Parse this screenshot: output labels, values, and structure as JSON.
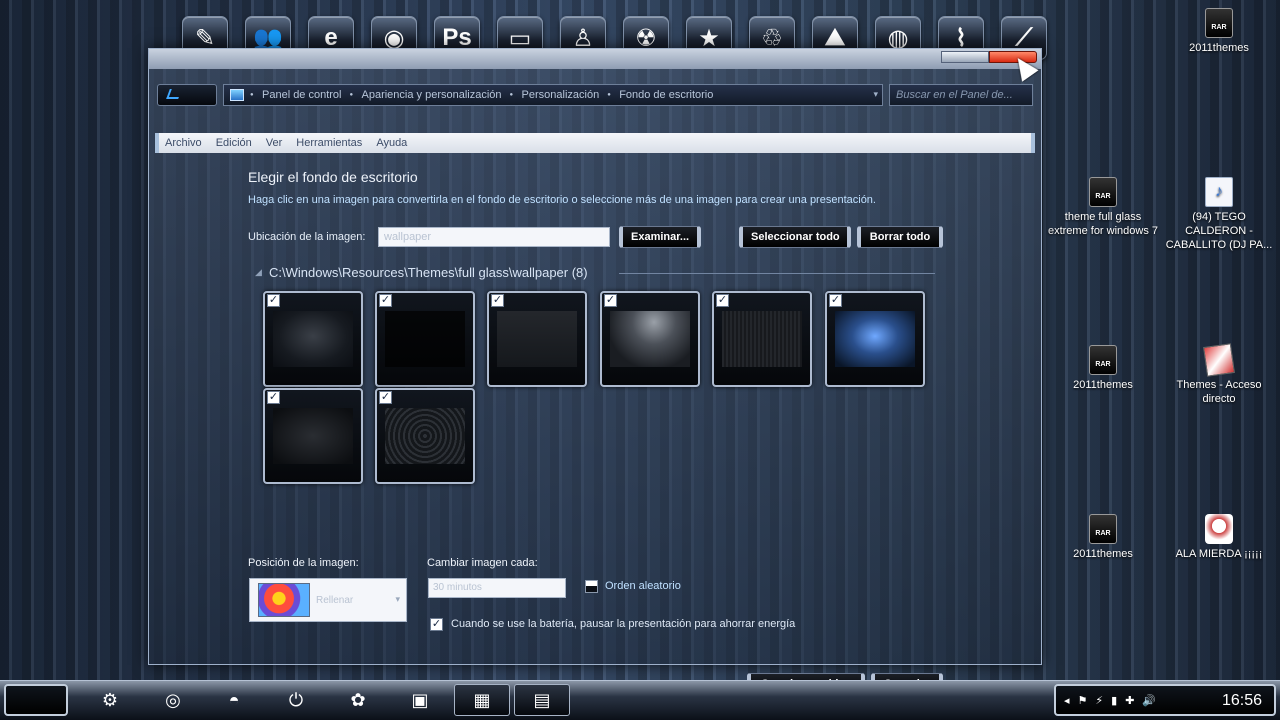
{
  "dock": {
    "icons": [
      {
        "name": "paint-brush-icon",
        "glyph": "✎"
      },
      {
        "name": "people-icon",
        "glyph": "👥"
      },
      {
        "name": "internet-explorer-icon",
        "glyph": "e"
      },
      {
        "name": "disc-icon",
        "glyph": "◉"
      },
      {
        "name": "photoshop-icon",
        "glyph": "Ps"
      },
      {
        "name": "presentation-icon",
        "glyph": "▭"
      },
      {
        "name": "user-lock-icon",
        "glyph": "♙"
      },
      {
        "name": "radiation-icon",
        "glyph": "☢"
      },
      {
        "name": "star-icon",
        "glyph": "★"
      },
      {
        "name": "recycle-icon",
        "glyph": "♲"
      },
      {
        "name": "image-icon",
        "glyph": "⛰"
      },
      {
        "name": "power-ring-icon",
        "glyph": "◍"
      },
      {
        "name": "broom-icon",
        "glyph": "⌇"
      },
      {
        "name": "brush-tool-icon",
        "glyph": "⟋"
      }
    ]
  },
  "desktop_icons": [
    {
      "label": "2011themes",
      "kind": "rar"
    },
    {
      "label": "theme full glass extreme for windows 7",
      "kind": "rar"
    },
    {
      "label": "(94) TEGO CALDERON - CABALLITO (DJ PA...",
      "kind": "music"
    },
    {
      "label": "2011themes",
      "kind": "rar"
    },
    {
      "label": "Themes - Acceso directo",
      "kind": "themes"
    },
    {
      "label": "2011themes",
      "kind": "rar"
    },
    {
      "label": "ALA MIERDA ¡¡¡¡¡",
      "kind": "mierda"
    }
  ],
  "address": {
    "breadcrumbs": [
      "Panel de control",
      "Apariencia y personalización",
      "Personalización",
      "Fondo de escritorio"
    ],
    "search_placeholder": "Buscar en el Panel de..."
  },
  "menu": [
    "Archivo",
    "Edición",
    "Ver",
    "Herramientas",
    "Ayuda"
  ],
  "content": {
    "title": "Elegir el fondo de escritorio",
    "subtitle": "Haga clic en una imagen para convertirla en el fondo de escritorio o seleccione más de una imagen para crear una presentación.",
    "location_label": "Ubicación de la imagen:",
    "location_value": "wallpaper",
    "browse_button": "Examinar...",
    "select_all_button": "Seleccionar todo",
    "clear_all_button": "Borrar todo",
    "folder_path": "C:\\Windows\\Resources\\Themes\\full glass\\wallpaper (8)",
    "thumbnails": [
      {
        "checked": true,
        "style": "radial-gradient(ellipse at 50% 45%, #3a3f47 0%, #161a20 60%, #0b0e13 100%)"
      },
      {
        "checked": true,
        "style": "linear-gradient(#050608, #020304)"
      },
      {
        "checked": true,
        "style": "linear-gradient(#24272c, #15181c)"
      },
      {
        "checked": true,
        "style": "radial-gradient(ellipse at 55% 20%, #9aa0a8 0%, #4b5058 35%, #1a1d22 75%)"
      },
      {
        "checked": true,
        "style": "repeating-linear-gradient(90deg, #23262b 0 2px, #17191d 2px 4px)"
      },
      {
        "checked": true,
        "style": "radial-gradient(ellipse at 50% 45%, #6fa8ff 0%, #2a4f8c 40%, #0a1628 90%)"
      },
      {
        "checked": true,
        "style": "radial-gradient(ellipse at 50% 50%, #2a2d32 0%, #0c0e11 90%)"
      },
      {
        "checked": true,
        "style": "repeating-radial-gradient(circle at 50% 50%, #2c3036 0 2px, #14171b 2px 5px)"
      }
    ],
    "position_label": "Posición de la imagen:",
    "position_value": "Rellenar",
    "interval_label": "Cambiar imagen cada:",
    "interval_value": "30 minutos",
    "shuffle_label": "Orden aleatorio",
    "battery_label": "Cuando se use la batería, pausar la presentación para ahorrar energía",
    "save_button": "Guardar cambios",
    "cancel_button": "Cancelar"
  },
  "taskbar": {
    "icons": [
      {
        "name": "settings-gear-icon",
        "glyph": "⚙"
      },
      {
        "name": "chrome-icon",
        "glyph": "◎"
      },
      {
        "name": "firefox-icon",
        "glyph": "◓"
      },
      {
        "name": "power-icon",
        "glyph": "⏻"
      },
      {
        "name": "windows-update-icon",
        "glyph": "✿"
      },
      {
        "name": "contacts-icon",
        "glyph": "▣"
      },
      {
        "name": "personalization-icon",
        "glyph": "▦"
      },
      {
        "name": "media-app-icon",
        "glyph": "▤"
      }
    ],
    "clock": "16:56"
  }
}
